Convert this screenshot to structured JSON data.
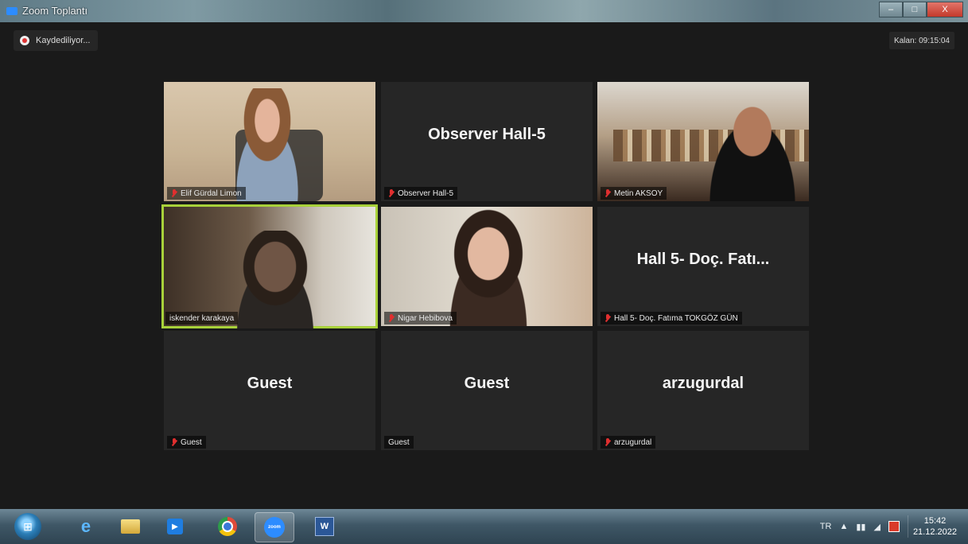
{
  "window": {
    "title": "Zoom Toplantı",
    "controls": {
      "minimize": "–",
      "maximize": "□",
      "close": "X"
    }
  },
  "meeting": {
    "recording_label": "Kaydediliyor...",
    "timer": "Kalan: 09:15:04",
    "participants": [
      {
        "display_name": "",
        "name_tag": "Elif Gürdal Limon",
        "muted": true,
        "video": true
      },
      {
        "display_name": "Observer Hall-5",
        "name_tag": "Observer Hall-5",
        "muted": true,
        "video": false
      },
      {
        "display_name": "",
        "name_tag": "Metin AKSOY",
        "muted": true,
        "video": true
      },
      {
        "display_name": "",
        "name_tag": "iskender karakaya",
        "muted": false,
        "video": true,
        "active_speaker": true
      },
      {
        "display_name": "",
        "name_tag": "Nigar Hebibova",
        "muted": true,
        "video": true
      },
      {
        "display_name": "Hall 5- Doç. Fatı...",
        "name_tag": "Hall 5- Doç. Fatıma TOKGÖZ GÜN",
        "muted": true,
        "video": false
      },
      {
        "display_name": "Guest",
        "name_tag": "Guest",
        "muted": true,
        "video": false
      },
      {
        "display_name": "Guest",
        "name_tag": "Guest",
        "muted": false,
        "video": false
      },
      {
        "display_name": "arzugurdal",
        "name_tag": "arzugurdal",
        "muted": true,
        "video": false
      }
    ]
  },
  "taskbar": {
    "start_icon": "windows-start-icon",
    "apps": [
      {
        "name": "internet-explorer",
        "glyph": "e"
      },
      {
        "name": "file-explorer",
        "glyph": ""
      },
      {
        "name": "media-player",
        "glyph": "▶"
      },
      {
        "name": "chrome",
        "glyph": ""
      },
      {
        "name": "zoom",
        "glyph": "zoom"
      },
      {
        "name": "word",
        "glyph": "W"
      }
    ],
    "tray": {
      "language": "TR",
      "time": "15:42",
      "date": "21.12.2022"
    }
  },
  "colors": {
    "active_speaker_border": "#a8d13a",
    "tile_bg": "#262626",
    "meeting_bg": "#1a1a1a",
    "mute_red": "#e02f2f",
    "zoom_blue": "#2d8cff"
  }
}
